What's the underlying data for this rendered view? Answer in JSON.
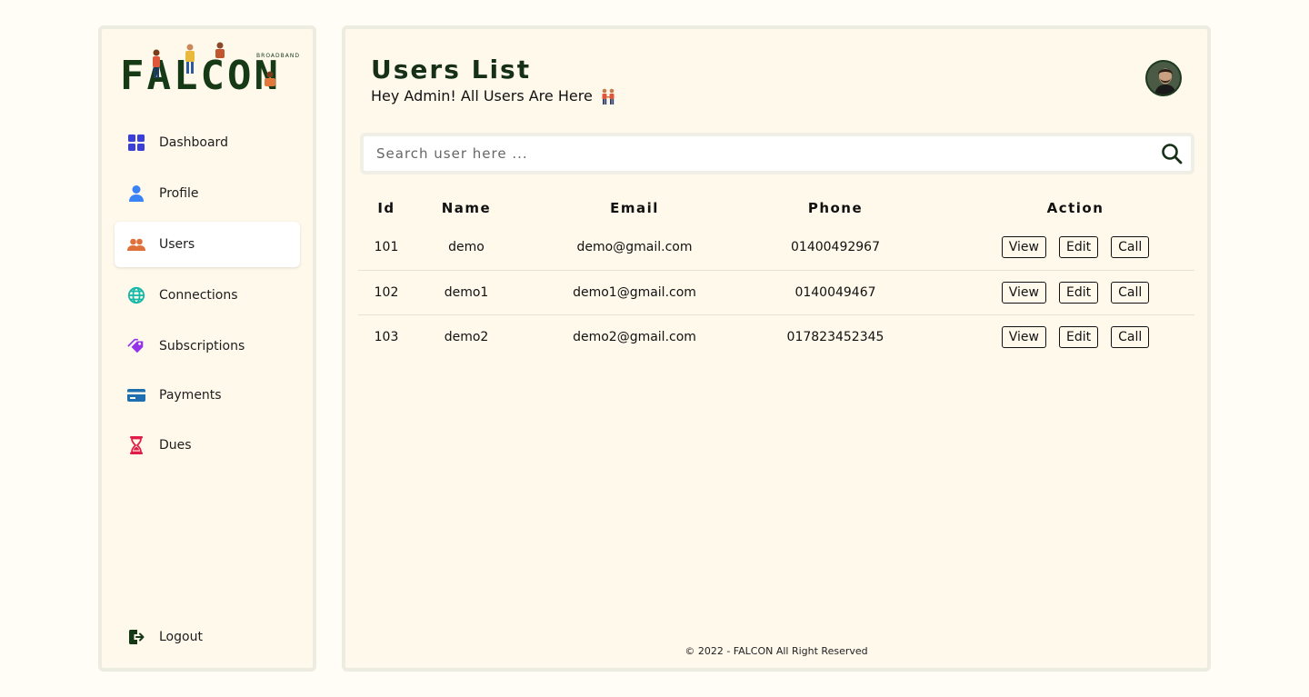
{
  "brand": {
    "name": "FALCON",
    "tagline": "BROADBAND"
  },
  "sidebar": {
    "items": [
      {
        "label": "Dashboard",
        "icon": "dashboard-grid-icon",
        "active": false
      },
      {
        "label": "Profile",
        "icon": "user-icon",
        "active": false
      },
      {
        "label": "Users",
        "icon": "users-icon",
        "active": true
      },
      {
        "label": "Connections",
        "icon": "globe-icon",
        "active": false
      },
      {
        "label": "Subscriptions",
        "icon": "tags-icon",
        "active": false
      },
      {
        "label": "Payments",
        "icon": "credit-card-icon",
        "active": false
      },
      {
        "label": "Dues",
        "icon": "hourglass-icon",
        "active": false
      }
    ],
    "logout_label": "Logout"
  },
  "header": {
    "title": "Users List",
    "subtitle": "Hey Admin! All Users Are Here"
  },
  "search": {
    "placeholder": "Search user here ..."
  },
  "table": {
    "columns": [
      "Id",
      "Name",
      "Email",
      "Phone",
      "Action"
    ],
    "rows": [
      {
        "id": "101",
        "name": "demo",
        "email": "demo@gmail.com",
        "phone": "01400492967"
      },
      {
        "id": "102",
        "name": "demo1",
        "email": "demo1@gmail.com",
        "phone": "0140049467"
      },
      {
        "id": "103",
        "name": "demo2",
        "email": "demo2@gmail.com",
        "phone": "017823452345"
      }
    ],
    "actions": {
      "view": "View",
      "edit": "Edit",
      "call": "Call"
    }
  },
  "footer": {
    "text": "© 2022 - FALCON All Right Reserved"
  },
  "colors": {
    "page_bg": "#fffdf6",
    "panel_bg": "#fff9ec",
    "brand_green": "#163a16",
    "dashboard_icon": "#3a3fd9",
    "profile_icon": "#3b82f6",
    "users_icon": "#e0703a",
    "connections_icon": "#14b8a6",
    "subscriptions_icon": "#9333ea",
    "payments_icon": "#1e6fb0",
    "dues_icon": "#e11d48"
  }
}
